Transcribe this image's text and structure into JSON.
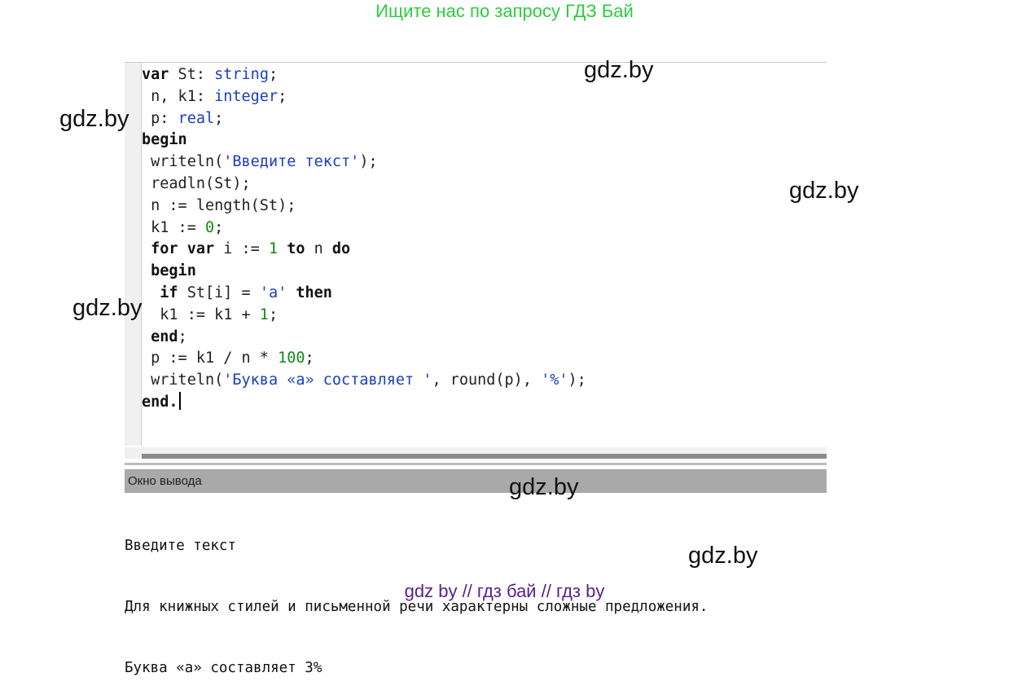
{
  "banner": "Ищите нас по запросу ГДЗ Бай",
  "editor": {
    "lines": [
      [
        {
          "t": "var",
          "c": "kw"
        },
        {
          "t": " St: ",
          "c": ""
        },
        {
          "t": "string",
          "c": "ty"
        },
        {
          "t": ";",
          "c": ""
        }
      ],
      [
        {
          "t": " n, k1: ",
          "c": ""
        },
        {
          "t": "integer",
          "c": "ty"
        },
        {
          "t": ";",
          "c": ""
        }
      ],
      [
        {
          "t": " p: ",
          "c": ""
        },
        {
          "t": "real",
          "c": "ty"
        },
        {
          "t": ";",
          "c": ""
        }
      ],
      [
        {
          "t": "begin",
          "c": "kw"
        }
      ],
      [
        {
          "t": " writeln(",
          "c": ""
        },
        {
          "t": "'Введите текст'",
          "c": "st"
        },
        {
          "t": ");",
          "c": ""
        }
      ],
      [
        {
          "t": " readln(St);",
          "c": ""
        }
      ],
      [
        {
          "t": " n := length(St);",
          "c": ""
        }
      ],
      [
        {
          "t": " k1 := ",
          "c": ""
        },
        {
          "t": "0",
          "c": "nm"
        },
        {
          "t": ";",
          "c": ""
        }
      ],
      [
        {
          "t": " ",
          "c": ""
        },
        {
          "t": "for var",
          "c": "kw"
        },
        {
          "t": " i := ",
          "c": ""
        },
        {
          "t": "1",
          "c": "nm"
        },
        {
          "t": " ",
          "c": ""
        },
        {
          "t": "to",
          "c": "kw"
        },
        {
          "t": " n ",
          "c": ""
        },
        {
          "t": "do",
          "c": "kw"
        }
      ],
      [
        {
          "t": " ",
          "c": ""
        },
        {
          "t": "begin",
          "c": "kw"
        }
      ],
      [
        {
          "t": "  ",
          "c": ""
        },
        {
          "t": "if",
          "c": "kw"
        },
        {
          "t": " St[i] = ",
          "c": ""
        },
        {
          "t": "'a'",
          "c": "st"
        },
        {
          "t": " ",
          "c": ""
        },
        {
          "t": "then",
          "c": "kw"
        }
      ],
      [
        {
          "t": "  k1 := k1 + ",
          "c": ""
        },
        {
          "t": "1",
          "c": "nm"
        },
        {
          "t": ";",
          "c": ""
        }
      ],
      [
        {
          "t": " ",
          "c": ""
        },
        {
          "t": "end",
          "c": "kw"
        },
        {
          "t": ";",
          "c": ""
        }
      ],
      [
        {
          "t": " p := k1 / n * ",
          "c": ""
        },
        {
          "t": "100",
          "c": "nm"
        },
        {
          "t": ";",
          "c": ""
        }
      ],
      [
        {
          "t": " writeln(",
          "c": ""
        },
        {
          "t": "'Буква «а» составляет '",
          "c": "st"
        },
        {
          "t": ", round(p), ",
          "c": ""
        },
        {
          "t": "'%'",
          "c": "st"
        },
        {
          "t": ");",
          "c": ""
        }
      ],
      [
        {
          "t": "end.",
          "c": "kw"
        },
        {
          "t": "",
          "c": "caret"
        }
      ]
    ]
  },
  "output": {
    "header": "Окно вывода",
    "lines": [
      "Введите текст",
      "Для книжных стилей и письменной речи характерны сложные предложения.",
      "Буква «а» составляет 3%"
    ]
  },
  "watermarks": [
    "gdz.by",
    "gdz.by",
    "gdz.by",
    "gdz.by",
    "gdz.by",
    "gdz.by"
  ],
  "footer": "gdz by  //  гдз бай  //  гдз by"
}
